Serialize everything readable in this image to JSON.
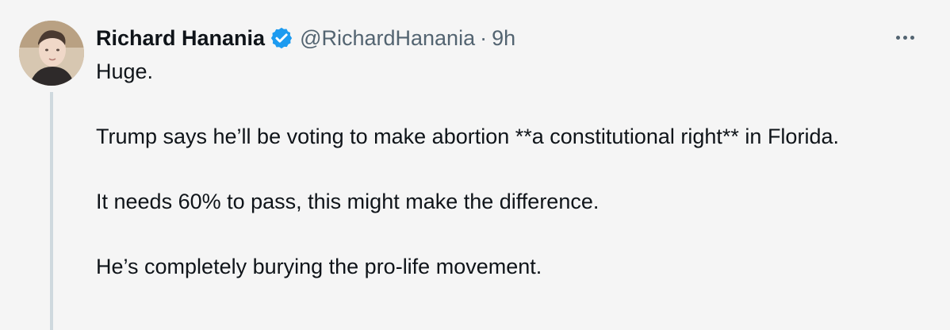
{
  "tweet": {
    "author": {
      "display_name": "Richard Hanania",
      "handle": "@RichardHanania",
      "verified": true,
      "avatar_icon": "avatar-photo"
    },
    "separator": "·",
    "time": "9h",
    "more_icon": "ellipsis-icon",
    "body": [
      "Huge.",
      "Trump says he’ll be voting to make abortion **a constitutional right** in Florida.",
      "It needs 60% to pass, this might make the difference.",
      "He’s completely burying the pro-life movement."
    ]
  },
  "colors": {
    "background": "#f5f5f5",
    "text": "#0f1419",
    "secondary_text": "#536471",
    "verified_blue": "#1d9bf0",
    "thread_line": "#cfd9de"
  }
}
